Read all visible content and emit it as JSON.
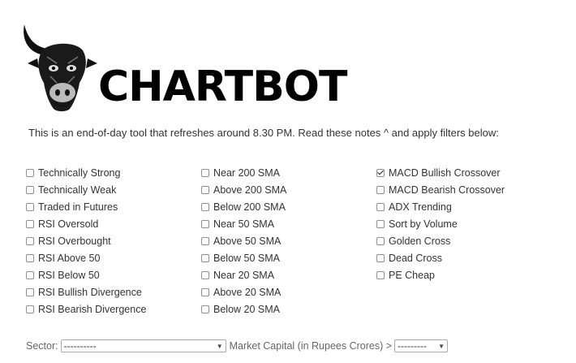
{
  "brand": {
    "name": "CHARTBOT"
  },
  "intro": "This is an end-of-day tool that refreshes around 8.30 PM. Read these notes ^ and apply filters below:",
  "filters": {
    "col1": [
      {
        "label": "Technically Strong",
        "checked": false
      },
      {
        "label": "Technically Weak",
        "checked": false
      },
      {
        "label": "Traded in Futures",
        "checked": false
      },
      {
        "label": "RSI Oversold",
        "checked": false
      },
      {
        "label": "RSI Overbought",
        "checked": false
      },
      {
        "label": "RSI Above 50",
        "checked": false
      },
      {
        "label": "RSI Below 50",
        "checked": false
      },
      {
        "label": "RSI Bullish Divergence",
        "checked": false
      },
      {
        "label": "RSI Bearish Divergence",
        "checked": false
      }
    ],
    "col2": [
      {
        "label": "Near 200 SMA",
        "checked": false
      },
      {
        "label": "Above 200 SMA",
        "checked": false
      },
      {
        "label": "Below 200 SMA",
        "checked": false
      },
      {
        "label": "Near 50 SMA",
        "checked": false
      },
      {
        "label": "Above 50 SMA",
        "checked": false
      },
      {
        "label": "Below 50 SMA",
        "checked": false
      },
      {
        "label": "Near 20 SMA",
        "checked": false
      },
      {
        "label": "Above 20 SMA",
        "checked": false
      },
      {
        "label": "Below 20 SMA",
        "checked": false
      }
    ],
    "col3": [
      {
        "label": "MACD Bullish Crossover",
        "checked": true
      },
      {
        "label": "MACD Bearish Crossover",
        "checked": false
      },
      {
        "label": "ADX Trending",
        "checked": false
      },
      {
        "label": "Sort by Volume",
        "checked": false
      },
      {
        "label": "Golden Cross",
        "checked": false
      },
      {
        "label": "Dead Cross",
        "checked": false
      },
      {
        "label": "PE Cheap",
        "checked": false
      }
    ]
  },
  "bottom": {
    "sector_label": "Sector:",
    "sector_value": "----------",
    "mcap_label": "Market Capital (in Rupees Crores) >",
    "mcap_value": "---------"
  }
}
